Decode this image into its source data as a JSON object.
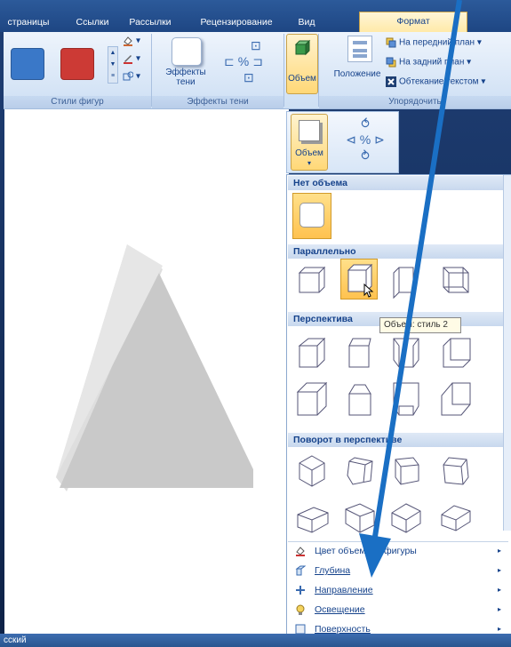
{
  "tabs": [
    "страницы",
    "Ссылки",
    "Рассылки",
    "Рецензирование",
    "Вид",
    "Формат"
  ],
  "ribbon": {
    "shape_styles_label": "Стили фигур",
    "shadow_effects_button": "Эффекты\nтени",
    "shadow_effects_label": "Эффекты тени",
    "volume_button": "Объем",
    "position_button": "Положение",
    "bring_front": "На передний план",
    "send_back": "На задний план",
    "text_wrap": "Обтекание текстом",
    "arrange_label": "Упорядочить",
    "swatch_blue": "#3a78c8",
    "swatch_red": "#cc3a35"
  },
  "minibar": {
    "volume_label": "Объем"
  },
  "gallery": {
    "no_volume": "Нет объема",
    "parallel": "Параллельно",
    "perspective": "Перспектива",
    "perspective_rotation": "Поворот в перспективе",
    "tooltip": "Объем: стиль 2"
  },
  "menu": [
    {
      "label": "Цвет объемной фигуры"
    },
    {
      "label": "Глубина"
    },
    {
      "label": "Направление"
    },
    {
      "label": "Освещение"
    },
    {
      "label": "Поверхность"
    }
  ],
  "status": {
    "language": "сский"
  },
  "colors": {
    "arrow": "#1a6fc4",
    "selected": "#ffcf6a"
  }
}
